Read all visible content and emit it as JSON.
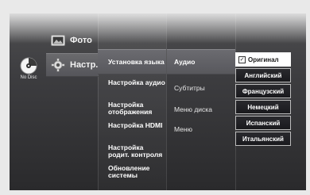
{
  "disc": {
    "label": "No Disc",
    "icon": "disc-icon"
  },
  "main_menu": [
    {
      "label": "Фото",
      "icon": "photo-icon",
      "selected": false
    },
    {
      "label": "Настр.",
      "icon": "gear-icon",
      "selected": true
    }
  ],
  "sub_menu": [
    {
      "label": "Установка языка",
      "active": true
    },
    {
      "label": "Настройка аудио"
    },
    {
      "label": "Настройка отображения"
    },
    {
      "label": "Настройка HDMI"
    },
    {
      "label": "Настройка родит. контроля"
    },
    {
      "label": "Обновление системы"
    }
  ],
  "settings": [
    {
      "label": "Аудио",
      "active": true
    },
    {
      "label": "Субтитры"
    },
    {
      "label": "Меню диска"
    },
    {
      "label": "Меню"
    }
  ],
  "dropdown": {
    "options": [
      {
        "label": "Оригинал",
        "selected": true
      },
      {
        "label": "Английский"
      },
      {
        "label": "Французский"
      },
      {
        "label": "Немецкий"
      },
      {
        "label": "Испанский"
      },
      {
        "label": "Итальянский"
      }
    ],
    "check_mark": "✓"
  }
}
